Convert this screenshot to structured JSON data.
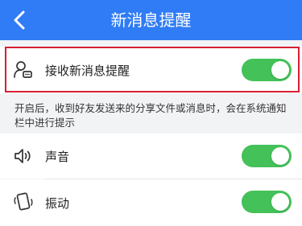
{
  "header": {
    "title": "新消息提醒",
    "back_icon": "chevron-left-icon",
    "background_color": "#2f7cf6"
  },
  "settings": {
    "receive": {
      "label": "接收新消息提醒",
      "icon": "person-chat-icon",
      "enabled": true,
      "highlighted": true
    },
    "description": "开启后，收到好友发送来的分享文件或消息时，会在系统通知栏中进行提示",
    "sound": {
      "label": "声音",
      "icon": "speaker-icon",
      "enabled": true
    },
    "vibrate": {
      "label": "振动",
      "icon": "phone-vibrate-icon",
      "enabled": true
    }
  },
  "colors": {
    "toggle_on": "#44c158",
    "highlight_border": "#d71f33"
  }
}
